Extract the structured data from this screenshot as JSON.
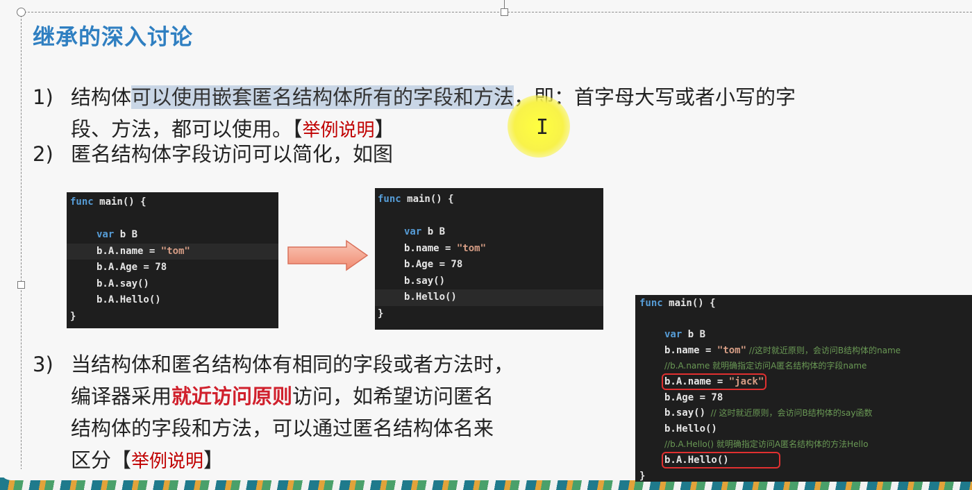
{
  "title": "继承的深入讨论",
  "items": [
    {
      "num": "1)",
      "line1_a": "结构体",
      "line1_hl": "可以使用嵌套匿名结构体所有的字段和方法",
      "line1_b": "，即：首字母大写或者小写的字",
      "line2_a": "段、方法，都可以使用。",
      "bracket_open": "【",
      "example": "举例说明",
      "bracket_close": "】"
    },
    {
      "num": "2)",
      "text": "匿名结构体字段访问可以简化，如图"
    },
    {
      "num": "3)",
      "line1": "当结构体和匿名结构体有相同的字段或者方法时，",
      "line2_a": "编译器采用",
      "line2_emph": "就近访问原则",
      "line2_b": "访问，如希望访问匿名",
      "line3": "结构体的字段和方法，可以通过匿名结构体名来",
      "line4_a": "区分",
      "bracket_open": "【",
      "example": "举例说明",
      "bracket_close": "】"
    }
  ],
  "code_left": {
    "l1_kw": "func",
    "l1_rest": " main() {",
    "l2": "",
    "l3_kw": "var",
    "l3_rest": " b B",
    "l4_a": "b.A.name = ",
    "l4_str": "\"tom\"",
    "l5": "b.A.Age = 78",
    "l6": "b.A.say()",
    "l7": "b.A.Hello()",
    "l8": "}"
  },
  "code_mid": {
    "l1_kw": "func",
    "l1_rest": " main() {",
    "l2": "",
    "l3_kw": "var",
    "l3_rest": " b B",
    "l4_a": "b.name = ",
    "l4_str": "\"tom\"",
    "l5": "b.Age = 78",
    "l6": "b.say()",
    "l7": "b.Hello()",
    "l8": "}"
  },
  "code_right": {
    "l1_kw": "func",
    "l1_rest": " main() {",
    "l2": "",
    "l3_kw": "var",
    "l3_rest": " b B",
    "l4_a": "b.name = ",
    "l4_str": "\"tom\"",
    "l4_cm": " //这时就近原则，会访问B结构体的name",
    "l5_cm": "//b.A.name 就明确指定访问A匿名结构体的字段name",
    "l6_a": "b.A.name = ",
    "l6_str": "\"jack\"",
    "l7": "b.Age = 78",
    "l8_a": "b.say()",
    "l8_cm": "  // 这时就近原则，会访问B结构体的say函数",
    "l9": "b.Hello()",
    "l10_cm": "//b.A.Hello() 就明确指定访问A匿名结构体的方法Hello",
    "l11": "b.A.Hello()",
    "l12": "}"
  },
  "colors": {
    "title": "#2f7fc1",
    "highlight": "#c9d6e6",
    "example_red": "#c00000",
    "emphasis_red": "#d0202c",
    "code_bg": "#1e1e1e",
    "keyword": "#569cd6",
    "string": "#d69d85",
    "cursor_glow": "#f8f24a"
  },
  "icons": [
    "arrow-right-icon",
    "text-cursor-icon"
  ]
}
